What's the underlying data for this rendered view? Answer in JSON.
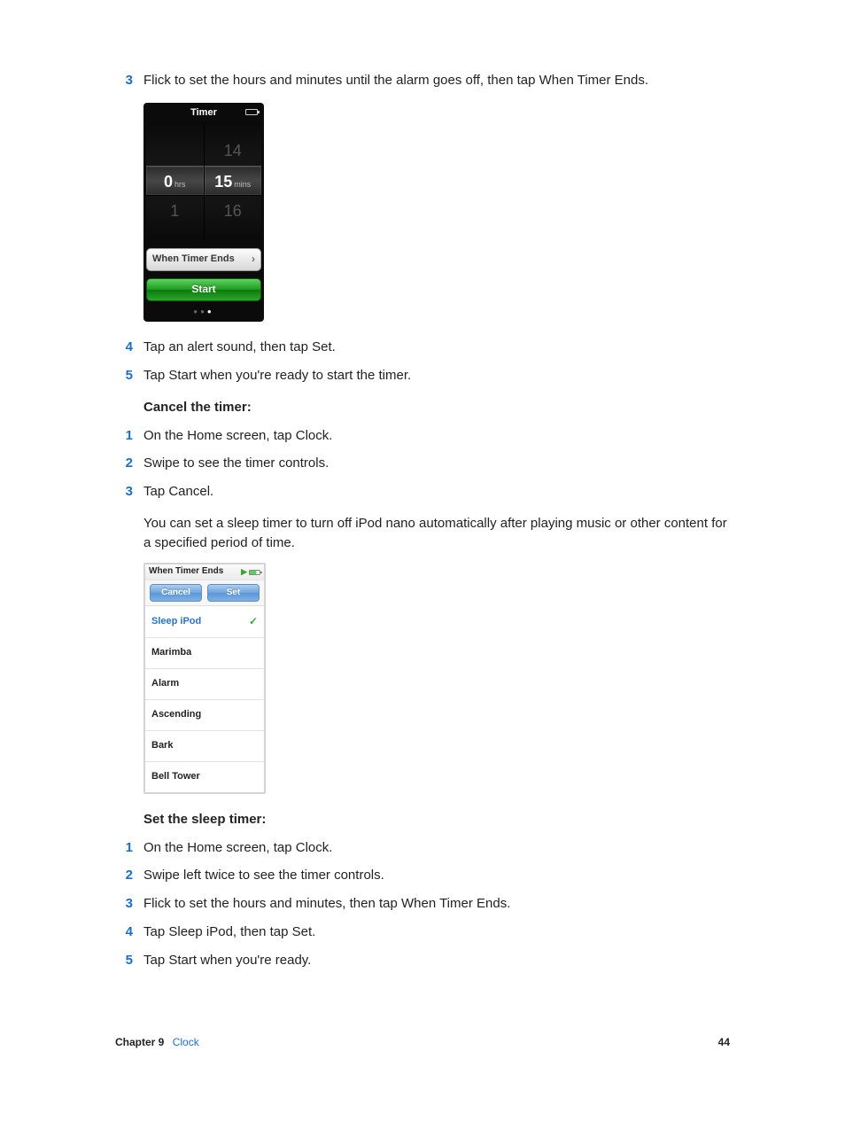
{
  "steps_top": {
    "3": "Flick to set the hours and minutes until the alarm goes off, then tap When Timer Ends."
  },
  "timer_device": {
    "title": "Timer",
    "hours_prev": "",
    "hours_sel": "0",
    "hours_unit": "hrs",
    "hours_next": "1",
    "mins_prev": "14",
    "mins_sel": "15",
    "mins_unit": "mins",
    "mins_next": "16",
    "ends_label": "When Timer Ends",
    "start_label": "Start"
  },
  "steps_mid": {
    "4": "Tap an alert sound, then tap Set.",
    "5": "Tap Start when you're ready to start the timer."
  },
  "cancel_section": {
    "heading": "Cancel the timer:",
    "1": "On the Home screen, tap Clock.",
    "2": "Swipe to see the timer controls.",
    "3": "Tap Cancel."
  },
  "sleep_para": "You can set a sleep timer to turn off iPod nano automatically after playing music or other content for a specified period of time.",
  "ends_device": {
    "title": "When Timer Ends",
    "cancel": "Cancel",
    "set": "Set",
    "items": {
      "0": "Sleep iPod",
      "1": "Marimba",
      "2": "Alarm",
      "3": "Ascending",
      "4": "Bark",
      "5": "Bell Tower"
    }
  },
  "sleep_section": {
    "heading": "Set the sleep timer:",
    "1": "On the Home screen, tap Clock.",
    "2": "Swipe left twice to see the timer controls.",
    "3": "Flick to set the hours and minutes, then tap When Timer Ends.",
    "4": "Tap Sleep iPod, then tap Set.",
    "5": "Tap Start when you're ready."
  },
  "footer": {
    "chapter_label": "Chapter  9",
    "chapter_link": "Clock",
    "page_number": "44"
  }
}
